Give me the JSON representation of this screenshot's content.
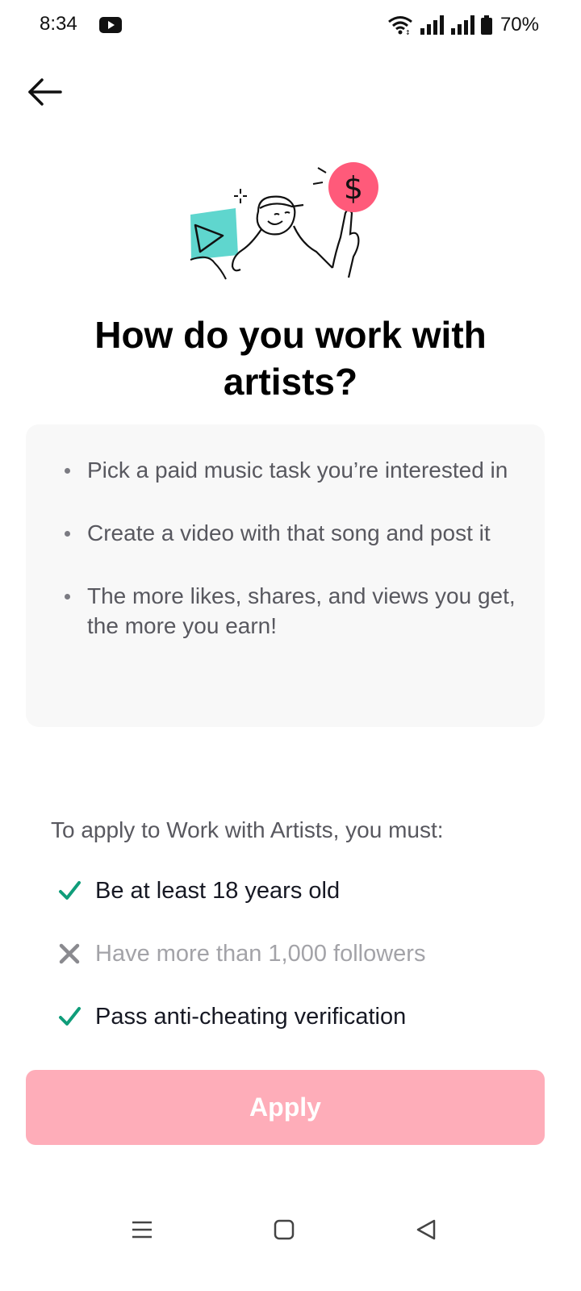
{
  "status_bar": {
    "time": "8:34",
    "battery": "70%",
    "icons": [
      "youtube-icon",
      "wifi-icon",
      "signal-icon",
      "signal-icon",
      "battery-icon"
    ]
  },
  "header": {
    "back_icon": "arrow-left-icon"
  },
  "hero": {
    "illustration": "artist-earning-illustration",
    "colors": {
      "accent_teal": "#5fd6ce",
      "accent_pink": "#fe2c55"
    }
  },
  "title": "How do you work with artists?",
  "info": {
    "items": [
      "Pick a paid music task you’re interested in",
      "Create a video with that song and post it",
      "The more likes, shares, and views you get, the more you earn!"
    ]
  },
  "requirements": {
    "intro": "To apply to Work with Artists, you must:",
    "items": [
      {
        "text": "Be at least 18 years old",
        "met": true,
        "icon": "check-icon"
      },
      {
        "text": "Have more than 1,000 followers",
        "met": false,
        "icon": "cross-icon"
      },
      {
        "text": "Pass anti-cheating verification",
        "met": true,
        "icon": "check-icon"
      }
    ],
    "colors": {
      "met": "#0f9d7a",
      "unmet": "#8a8a8f"
    }
  },
  "apply": {
    "label": "Apply",
    "disabled": true,
    "color": "#feadb9"
  },
  "nav_bar": {
    "icons": [
      "menu-icon",
      "home-square-icon",
      "back-triangle-icon"
    ]
  }
}
